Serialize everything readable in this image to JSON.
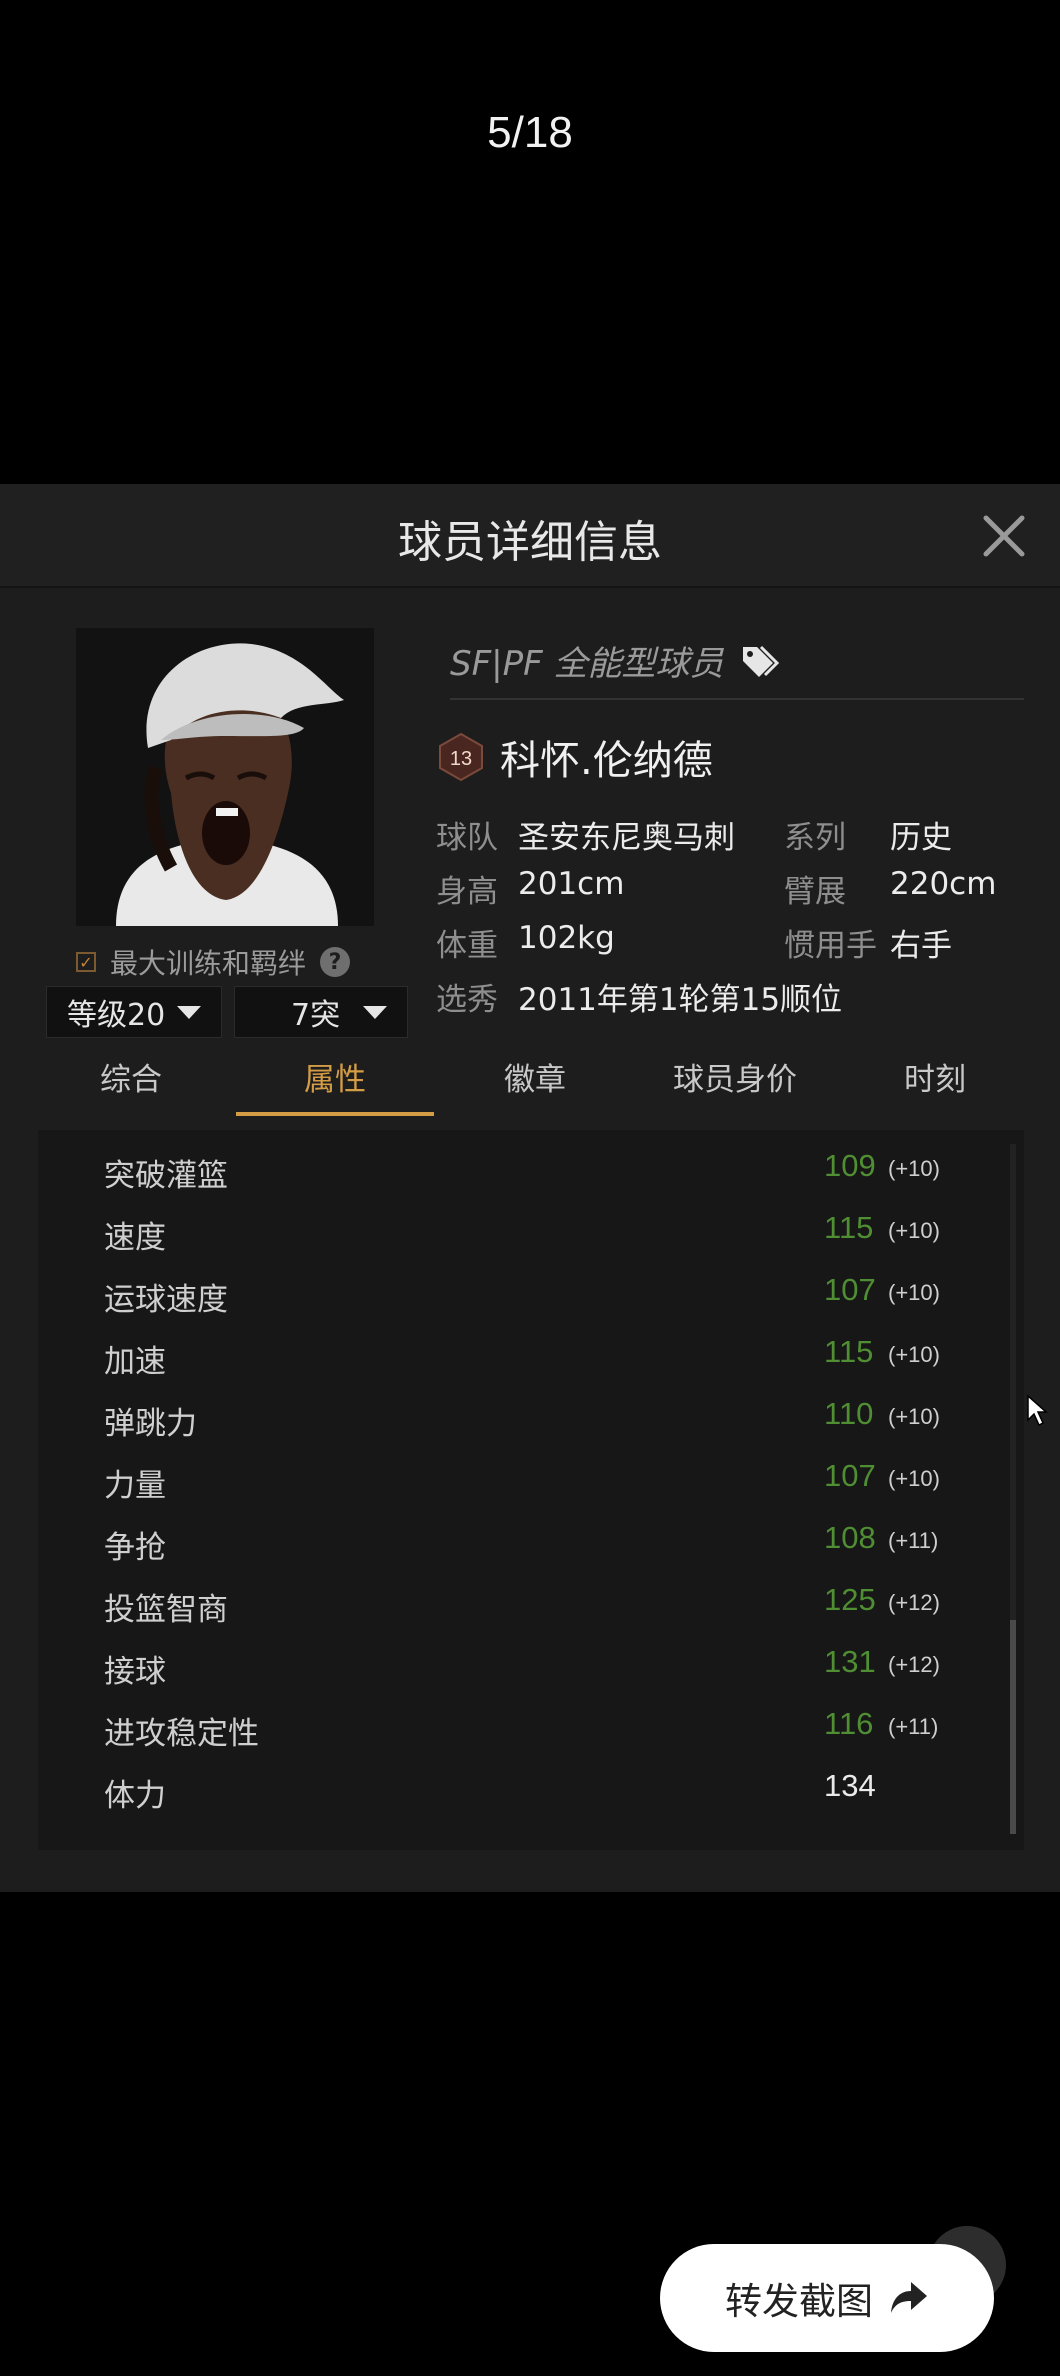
{
  "counter": "5/18",
  "panel": {
    "title": "球员详细信息",
    "positions": "SF|PF 全能型球员",
    "badge_number": "13",
    "player_name": "科怀.伦纳德",
    "max_training": "最大训练和羁绊",
    "level_select": "等级20",
    "breakthrough_select": "7突",
    "info": {
      "team_label": "球队",
      "team_value": "圣安东尼奥马刺",
      "series_label": "系列",
      "series_value": "历史",
      "height_label": "身高",
      "height_value": "201cm",
      "wingspan_label": "臂展",
      "wingspan_value": "220cm",
      "weight_label": "体重",
      "weight_value": "102kg",
      "hand_label": "惯用手",
      "hand_value": "右手",
      "draft_label": "选秀",
      "draft_value": "2011年第1轮第15顺位"
    },
    "tabs": [
      "综合",
      "属性",
      "徽章",
      "球员身价",
      "时刻"
    ],
    "active_tab": "属性",
    "attributes": [
      {
        "label": "突破灌篮",
        "value": "109",
        "bonus": "(+10)"
      },
      {
        "label": "速度",
        "value": "115",
        "bonus": "(+10)"
      },
      {
        "label": "运球速度",
        "value": "107",
        "bonus": "(+10)"
      },
      {
        "label": "加速",
        "value": "115",
        "bonus": "(+10)"
      },
      {
        "label": "弹跳力",
        "value": "110",
        "bonus": "(+10)"
      },
      {
        "label": "力量",
        "value": "107",
        "bonus": "(+10)"
      },
      {
        "label": "争抢",
        "value": "108",
        "bonus": "(+11)"
      },
      {
        "label": "投篮智商",
        "value": "125",
        "bonus": "(+12)"
      },
      {
        "label": "接球",
        "value": "131",
        "bonus": "(+12)"
      },
      {
        "label": "进攻稳定性",
        "value": "116",
        "bonus": "(+11)"
      },
      {
        "label": "体力",
        "value": "134",
        "bonus": ""
      }
    ]
  },
  "share_button": "转发截图",
  "colors": {
    "accent": "#d39c45",
    "boost_green": "#4f8e32",
    "panel_bg": "#1d1d1d"
  }
}
